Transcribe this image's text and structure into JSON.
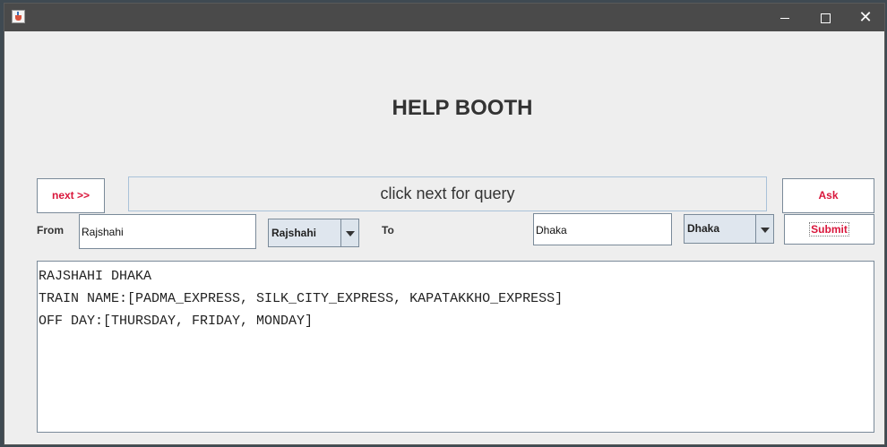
{
  "window": {
    "title": "",
    "controls": [
      "minimize-icon",
      "maximize-icon",
      "close-icon"
    ]
  },
  "heading": "HELP BOOTH",
  "query": {
    "next_label": "next >>",
    "banner_text": "click next for query",
    "ask_label": "Ask"
  },
  "route": {
    "from_label": "From",
    "from_value": "Rajshahi",
    "from_select": "Rajshahi",
    "to_label": "To",
    "to_value": "Dhaka",
    "to_select": "Dhaka",
    "submit_label": "Submit"
  },
  "result": {
    "lines": [
      "RAJSHAHI DHAKA",
      "TRAIN NAME:[PADMA_EXPRESS, SILK_CITY_EXPRESS, KAPATAKKHO_EXPRESS]",
      "OFF DAY:[THURSDAY, FRIDAY, MONDAY]"
    ]
  },
  "colors": {
    "titlebar": "#4a4a4a",
    "window_bg": "#eeeeee",
    "button_text": "#d9163b",
    "combo_bg": "#dfe6ee"
  }
}
